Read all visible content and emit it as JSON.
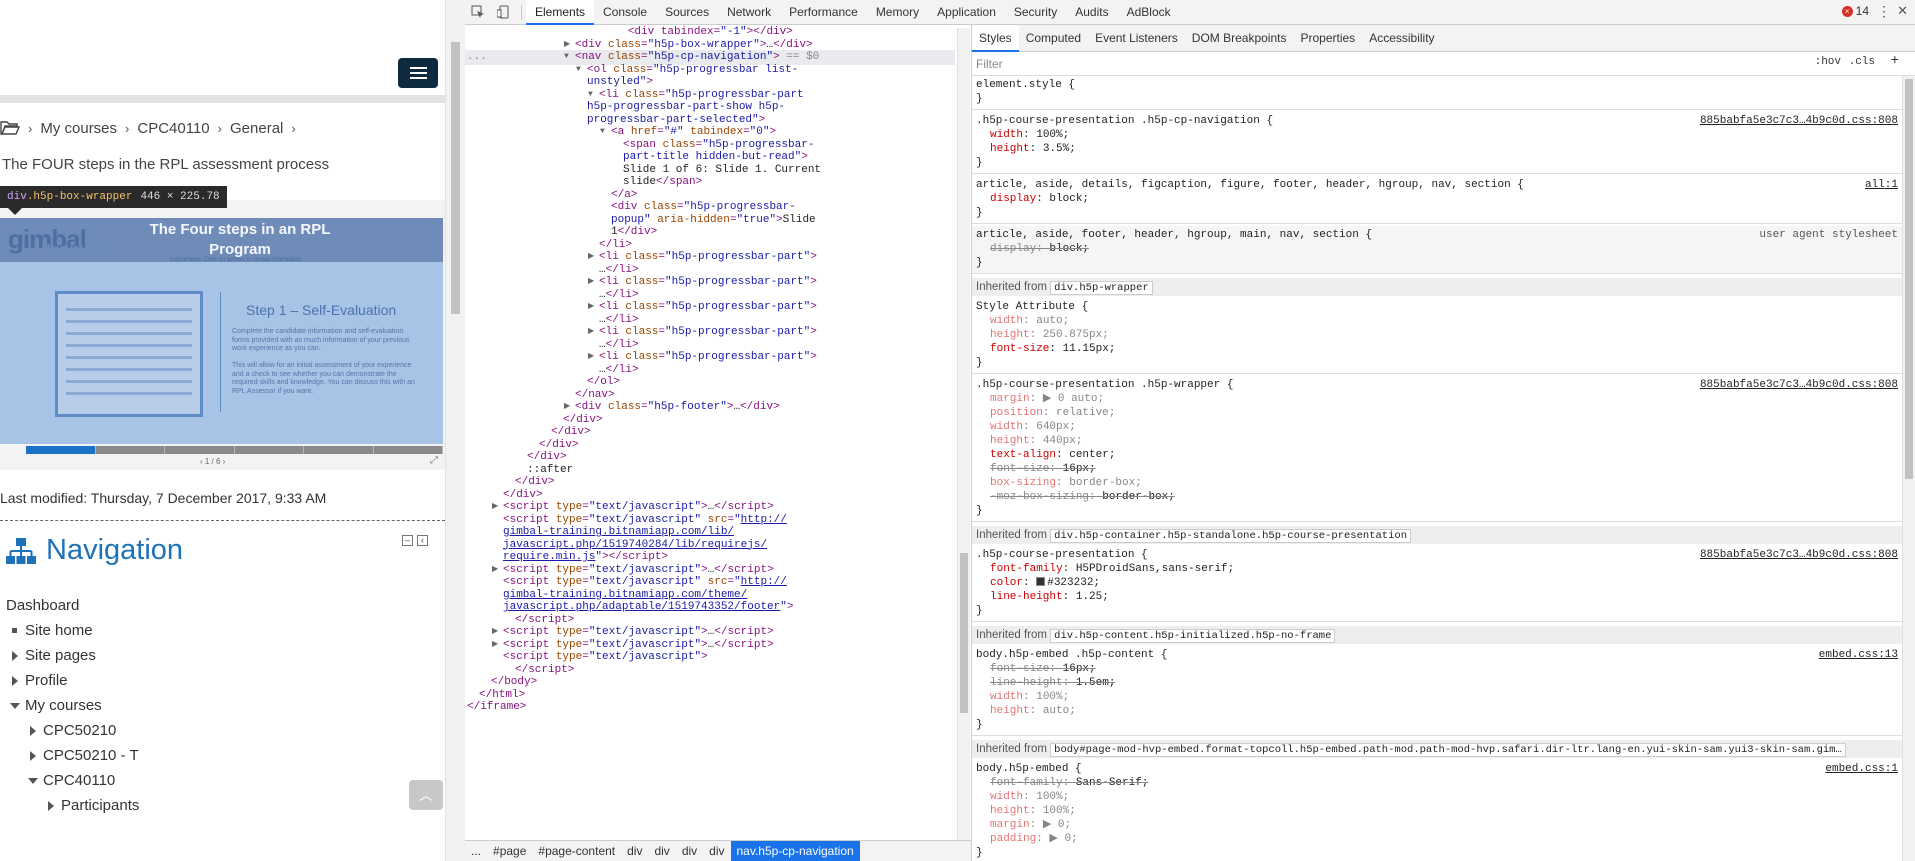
{
  "page": {
    "breadcrumb": [
      "My courses",
      "CPC40110",
      "General"
    ],
    "title": "The FOUR steps in the RPL assessment process",
    "tooltip": {
      "tag": "div",
      "cls": ".h5p-box-wrapper",
      "dims": "446 × 225.78"
    },
    "slide": {
      "logo_main": "gimbal",
      "logo_sub": "training",
      "title": "The Four steps in an RPL Program",
      "subtitle": "Instructions: Click on arrows to reveal information",
      "step": "Step 1 – Self-Evaluation",
      "text": "Complete the candidate information and self-evaluation forms provided with as much information of your previous work experience as you can.\n\nThis will allow for an initial assessment of your experience and a check to see whether you can demonstrate the required skills and knowledge. You can discuss this with an RPL Assessor if you want.",
      "pager": "‹ 1 / 6 ›",
      "progress": {
        "current": 1,
        "total": 6
      }
    },
    "last_modified": "Last modified: Thursday, 7 December 2017, 9:33 AM",
    "navigation": {
      "title": "Navigation",
      "items": [
        {
          "label": "Dashboard",
          "kind": "none",
          "indent": 0
        },
        {
          "label": "Site home",
          "kind": "leaf",
          "indent": 0
        },
        {
          "label": "Site pages",
          "kind": "collapsed",
          "indent": 0
        },
        {
          "label": "Profile",
          "kind": "collapsed",
          "indent": 0
        },
        {
          "label": "My courses",
          "kind": "expanded",
          "indent": 0
        },
        {
          "label": "CPC50210",
          "kind": "collapsed",
          "indent": 1
        },
        {
          "label": "CPC50210 - T",
          "kind": "collapsed",
          "indent": 1
        },
        {
          "label": "CPC40110",
          "kind": "expanded",
          "indent": 1
        },
        {
          "label": "Participants",
          "kind": "collapsed",
          "indent": 2
        }
      ]
    }
  },
  "devtools": {
    "tabs": [
      "Elements",
      "Console",
      "Sources",
      "Network",
      "Performance",
      "Memory",
      "Application",
      "Security",
      "Audits",
      "AdBlock"
    ],
    "active_tab": "Elements",
    "error_count": "14",
    "elements": [
      {
        "i": 110,
        "html": "<span class=\"gray\">        </span><span class=\"tagc\">&lt;div tabindex=</span><span class=\"val\">\"-1\"</span><span class=\"tagc\">&gt;&lt;/div&gt;</span>"
      },
      {
        "i": 110,
        "tri": "r",
        "html": "<span class=\"tagc\">&lt;div </span><span class=\"attr\">class</span><span class=\"tagc\">=</span><span class=\"val\">\"h5p-box-wrapper\"</span><span class=\"tagc\">&gt;</span><span class=\"txt\">…</span><span class=\"tagc\">&lt;/div&gt;</span>"
      },
      {
        "i": 110,
        "tri": "d",
        "sel": true,
        "html": "<span class=\"tagc\">&lt;nav </span><span class=\"attr\">class</span><span class=\"tagc\">=</span><span class=\"val\">\"h5p-cp-navigation\"</span><span class=\"tagc\">&gt;</span><span class=\"gray\"> == $0</span>"
      },
      {
        "i": 122,
        "tri": "d",
        "html": "<span class=\"tagc\">&lt;ol </span><span class=\"attr\">class</span><span class=\"tagc\">=</span><span class=\"val\">\"h5p-progressbar list-</span>"
      },
      {
        "i": 122,
        "html": "<span class=\"val\">unstyled\"</span><span class=\"tagc\">&gt;</span>"
      },
      {
        "i": 134,
        "tri": "d",
        "html": "<span class=\"tagc\">&lt;li </span><span class=\"attr\">class</span><span class=\"tagc\">=</span><span class=\"val\">\"h5p-progressbar-part</span>"
      },
      {
        "i": 122,
        "html": "<span class=\"val\">h5p-progressbar-part-show h5p-</span>"
      },
      {
        "i": 122,
        "html": "<span class=\"val\">progressbar-part-selected\"</span><span class=\"tagc\">&gt;</span>"
      },
      {
        "i": 146,
        "tri": "d",
        "html": "<span class=\"tagc\">&lt;a </span><span class=\"attr\">href</span><span class=\"tagc\">=</span><span class=\"val\">\"#\"</span><span class=\"attr\"> tabindex</span><span class=\"tagc\">=</span><span class=\"val\">\"0\"</span><span class=\"tagc\">&gt;</span>"
      },
      {
        "i": 158,
        "html": "<span class=\"tagc\">&lt;span </span><span class=\"attr\">class</span><span class=\"tagc\">=</span><span class=\"val\">\"h5p-progressbar-</span>"
      },
      {
        "i": 158,
        "html": "<span class=\"val\">part-title hidden-but-read\"</span><span class=\"tagc\">&gt;</span>"
      },
      {
        "i": 158,
        "html": "<span class=\"txt\">Slide 1 of 6: Slide 1. Current</span>"
      },
      {
        "i": 158,
        "html": "<span class=\"txt\">slide</span><span class=\"tagc\">&lt;/span&gt;</span>"
      },
      {
        "i": 146,
        "html": "<span class=\"tagc\">&lt;/a&gt;</span>"
      },
      {
        "i": 146,
        "html": "<span class=\"tagc\">&lt;div </span><span class=\"attr\">class</span><span class=\"tagc\">=</span><span class=\"val\">\"h5p-progressbar-</span>"
      },
      {
        "i": 146,
        "html": "<span class=\"val\">popup\"</span><span class=\"attr\"> aria-hidden</span><span class=\"tagc\">=</span><span class=\"val\">\"true\"</span><span class=\"tagc\">&gt;</span><span class=\"txt\">Slide</span>"
      },
      {
        "i": 146,
        "html": "<span class=\"txt\">1</span><span class=\"tagc\">&lt;/div&gt;</span>"
      },
      {
        "i": 134,
        "html": "<span class=\"tagc\">&lt;/li&gt;</span>"
      },
      {
        "i": 134,
        "tri": "r",
        "html": "<span class=\"tagc\">&lt;li </span><span class=\"attr\">class</span><span class=\"tagc\">=</span><span class=\"val\">\"h5p-progressbar-part\"</span><span class=\"tagc\">&gt;</span>"
      },
      {
        "i": 134,
        "html": "<span class=\"txt\">…</span><span class=\"tagc\">&lt;/li&gt;</span>"
      },
      {
        "i": 134,
        "tri": "r",
        "html": "<span class=\"tagc\">&lt;li </span><span class=\"attr\">class</span><span class=\"tagc\">=</span><span class=\"val\">\"h5p-progressbar-part\"</span><span class=\"tagc\">&gt;</span>"
      },
      {
        "i": 134,
        "html": "<span class=\"txt\">…</span><span class=\"tagc\">&lt;/li&gt;</span>"
      },
      {
        "i": 134,
        "tri": "r",
        "html": "<span class=\"tagc\">&lt;li </span><span class=\"attr\">class</span><span class=\"tagc\">=</span><span class=\"val\">\"h5p-progressbar-part\"</span><span class=\"tagc\">&gt;</span>"
      },
      {
        "i": 134,
        "html": "<span class=\"txt\">…</span><span class=\"tagc\">&lt;/li&gt;</span>"
      },
      {
        "i": 134,
        "tri": "r",
        "html": "<span class=\"tagc\">&lt;li </span><span class=\"attr\">class</span><span class=\"tagc\">=</span><span class=\"val\">\"h5p-progressbar-part\"</span><span class=\"tagc\">&gt;</span>"
      },
      {
        "i": 134,
        "html": "<span class=\"txt\">…</span><span class=\"tagc\">&lt;/li&gt;</span>"
      },
      {
        "i": 134,
        "tri": "r",
        "html": "<span class=\"tagc\">&lt;li </span><span class=\"attr\">class</span><span class=\"tagc\">=</span><span class=\"val\">\"h5p-progressbar-part\"</span><span class=\"tagc\">&gt;</span>"
      },
      {
        "i": 134,
        "html": "<span class=\"txt\">…</span><span class=\"tagc\">&lt;/li&gt;</span>"
      },
      {
        "i": 122,
        "html": "<span class=\"tagc\">&lt;/ol&gt;</span>"
      },
      {
        "i": 110,
        "html": "<span class=\"tagc\">&lt;/nav&gt;</span>"
      },
      {
        "i": 110,
        "tri": "r",
        "html": "<span class=\"tagc\">&lt;div </span><span class=\"attr\">class</span><span class=\"tagc\">=</span><span class=\"val\">\"h5p-footer\"</span><span class=\"tagc\">&gt;</span><span class=\"txt\">…</span><span class=\"tagc\">&lt;/div&gt;</span>"
      },
      {
        "i": 98,
        "html": "<span class=\"tagc\">&lt;/div&gt;</span>"
      },
      {
        "i": 86,
        "html": "<span class=\"tagc\">&lt;/div&gt;</span>"
      },
      {
        "i": 74,
        "html": "<span class=\"tagc\">&lt;/div&gt;</span>"
      },
      {
        "i": 62,
        "html": "<span class=\"tagc\">&lt;/div&gt;</span>"
      },
      {
        "i": 62,
        "html": "<span class=\"txt\">::after</span>"
      },
      {
        "i": 50,
        "html": "<span class=\"tagc\">&lt;/div&gt;</span>"
      },
      {
        "i": 38,
        "html": "<span class=\"tagc\">&lt;/div&gt;</span>"
      },
      {
        "i": 38,
        "tri": "r",
        "html": "<span class=\"tagc\">&lt;script </span><span class=\"attr\">type</span><span class=\"tagc\">=</span><span class=\"val\">\"text/javascript\"</span><span class=\"tagc\">&gt;</span><span class=\"txt\">…</span><span class=\"tagc\">&lt;/script&gt;</span>"
      },
      {
        "i": 38,
        "html": "<span class=\"tagc\">&lt;script </span><span class=\"attr\">type</span><span class=\"tagc\">=</span><span class=\"val\">\"text/javascript\"</span><span class=\"attr\"> src</span><span class=\"tagc\">=</span><span class=\"val\">\"</span><span class=\"lnk\">http://</span>"
      },
      {
        "i": 38,
        "html": "<span class=\"lnk\">gimbal-training.bitnamiapp.com/lib/</span>"
      },
      {
        "i": 38,
        "html": "<span class=\"lnk\">javascript.php/1519740284/lib/requirejs/</span>"
      },
      {
        "i": 38,
        "html": "<span class=\"lnk\">require.min.js</span><span class=\"val\">\"</span><span class=\"tagc\">&gt;&lt;/script&gt;</span>"
      },
      {
        "i": 38,
        "tri": "r",
        "html": "<span class=\"tagc\">&lt;script </span><span class=\"attr\">type</span><span class=\"tagc\">=</span><span class=\"val\">\"text/javascript\"</span><span class=\"tagc\">&gt;</span><span class=\"txt\">…</span><span class=\"tagc\">&lt;/script&gt;</span>"
      },
      {
        "i": 38,
        "html": "<span class=\"tagc\">&lt;script </span><span class=\"attr\">type</span><span class=\"tagc\">=</span><span class=\"val\">\"text/javascript\"</span><span class=\"attr\"> src</span><span class=\"tagc\">=</span><span class=\"val\">\"</span><span class=\"lnk\">http://</span>"
      },
      {
        "i": 38,
        "html": "<span class=\"lnk\">gimbal-training.bitnamiapp.com/theme/</span>"
      },
      {
        "i": 38,
        "html": "<span class=\"lnk\">javascript.php/adaptable/1519743352/footer</span><span class=\"val\">\"</span><span class=\"tagc\">&gt;</span>"
      },
      {
        "i": 50,
        "html": "<span class=\"tagc\">&lt;/script&gt;</span>"
      },
      {
        "i": 38,
        "tri": "r",
        "html": "<span class=\"tagc\">&lt;script </span><span class=\"attr\">type</span><span class=\"tagc\">=</span><span class=\"val\">\"text/javascript\"</span><span class=\"tagc\">&gt;</span><span class=\"txt\">…</span><span class=\"tagc\">&lt;/script&gt;</span>"
      },
      {
        "i": 38,
        "tri": "r",
        "html": "<span class=\"tagc\">&lt;script </span><span class=\"attr\">type</span><span class=\"tagc\">=</span><span class=\"val\">\"text/javascript\"</span><span class=\"tagc\">&gt;</span><span class=\"txt\">…</span><span class=\"tagc\">&lt;/script&gt;</span>"
      },
      {
        "i": 38,
        "html": "<span class=\"tagc\">&lt;script </span><span class=\"attr\">type</span><span class=\"tagc\">=</span><span class=\"val\">\"text/javascript\"</span><span class=\"tagc\">&gt;</span>"
      },
      {
        "i": 50,
        "html": "<span class=\"tagc\">&lt;/script&gt;</span>"
      },
      {
        "i": 26,
        "html": "<span class=\"tagc\">&lt;/body&gt;</span>"
      },
      {
        "i": 14,
        "html": "<span class=\"tagc\">&lt;/html&gt;</span>"
      },
      {
        "i": 2,
        "html": "<span class=\"tagc\">&lt;/iframe&gt;</span>"
      }
    ],
    "crumbs": [
      "...",
      "#page",
      "#page-content",
      "div",
      "div",
      "div",
      "div",
      "nav.h5p-cp-navigation"
    ],
    "styles_tabs": [
      "Styles",
      "Computed",
      "Event Listeners",
      "DOM Breakpoints",
      "Properties",
      "Accessibility"
    ],
    "filter_placeholder": "Filter",
    "hov": ":hov",
    "cls": ".cls",
    "plus": "+",
    "rules": [
      {
        "type": "rule",
        "selector": "element.style {",
        "props": [],
        "close": "}"
      },
      {
        "type": "rule",
        "selector": ".h5p-course-presentation .h5p-cp-navigation {",
        "src": "885babfa5e3c7c3…4b9c0d.css:808",
        "props": [
          {
            "n": "width",
            "v": "100%;"
          },
          {
            "n": "height",
            "v": "3.5%;"
          }
        ],
        "close": "}"
      },
      {
        "type": "rule",
        "selector": "article, aside, details, figcaption, figure, footer, header, hgroup, nav, section {",
        "src": "all:1",
        "props": [
          {
            "n": "display",
            "v": "block;"
          }
        ],
        "close": "}"
      },
      {
        "type": "rule",
        "ua": true,
        "selector": "article, aside, footer, header, hgroup, main, nav, section {",
        "src_ua": "user agent stylesheet",
        "props": [
          {
            "n": "display",
            "v": "block;",
            "strike": true
          }
        ],
        "close": "}"
      },
      {
        "type": "inh",
        "label": "Inherited from",
        "box": "div.h5p-wrapper"
      },
      {
        "type": "rule",
        "selector": "Style Attribute {",
        "props": [
          {
            "n": "width",
            "v": "auto;",
            "dim": true
          },
          {
            "n": "height",
            "v": "250.875px;",
            "dim": true
          },
          {
            "n": "font-size",
            "v": "11.15px;"
          }
        ],
        "close": "}"
      },
      {
        "type": "rule",
        "selector": ".h5p-course-presentation .h5p-wrapper {",
        "src": "885babfa5e3c7c3…4b9c0d.css:808",
        "props": [
          {
            "n": "margin",
            "v": "▶ 0 auto;",
            "dim": true
          },
          {
            "n": "position",
            "v": "relative;",
            "dim": true
          },
          {
            "n": "width",
            "v": "640px;",
            "dim": true
          },
          {
            "n": "height",
            "v": "440px;",
            "dim": true
          },
          {
            "n": "text-align",
            "v": "center;"
          },
          {
            "n": "font-size",
            "v": "16px;",
            "strike": true
          },
          {
            "n": "box-sizing",
            "v": "border-box;",
            "dim": true
          },
          {
            "n": "-moz-box-sizing",
            "v": "border-box;",
            "strike": true
          }
        ],
        "close": "}"
      },
      {
        "type": "inh",
        "label": "Inherited from",
        "box": "div.h5p-container.h5p-standalone.h5p-course-presentation"
      },
      {
        "type": "rule",
        "selector": ".h5p-course-presentation {",
        "src": "885babfa5e3c7c3…4b9c0d.css:808",
        "props": [
          {
            "n": "font-family",
            "v": "H5PDroidSans,sans-serif;"
          },
          {
            "n": "color",
            "v": "#323232;",
            "swatch": true
          },
          {
            "n": "line-height",
            "v": "1.25;"
          }
        ],
        "close": "}"
      },
      {
        "type": "inh",
        "label": "Inherited from",
        "box": "div.h5p-content.h5p-initialized.h5p-no-frame"
      },
      {
        "type": "rule",
        "selector": "body.h5p-embed .h5p-content {",
        "src": "embed.css:13",
        "props": [
          {
            "n": "font-size",
            "v": "16px;",
            "strike": true
          },
          {
            "n": "line-height",
            "v": "1.5em;",
            "strike": true
          },
          {
            "n": "width",
            "v": "100%;",
            "dim": true
          },
          {
            "n": "height",
            "v": "auto;",
            "dim": true
          }
        ],
        "close": "}"
      },
      {
        "type": "inh",
        "label": "Inherited from",
        "box": "body#page-mod-hvp-embed.format-topcoll.h5p-embed.path-mod.path-mod-hvp.safari.dir-ltr.lang-en.yui-skin-sam.yui3-skin-sam.gim…"
      },
      {
        "type": "rule",
        "selector": "body.h5p-embed {",
        "src": "embed.css:1",
        "props": [
          {
            "n": "font-family",
            "v": "Sans-Serif;",
            "strike": true
          },
          {
            "n": "width",
            "v": "100%;",
            "dim": true
          },
          {
            "n": "height",
            "v": "100%;",
            "dim": true
          },
          {
            "n": "margin",
            "v": "▶ 0;",
            "dim": true
          },
          {
            "n": "padding",
            "v": "▶ 0;",
            "dim": true
          }
        ],
        "close": "}"
      }
    ]
  }
}
